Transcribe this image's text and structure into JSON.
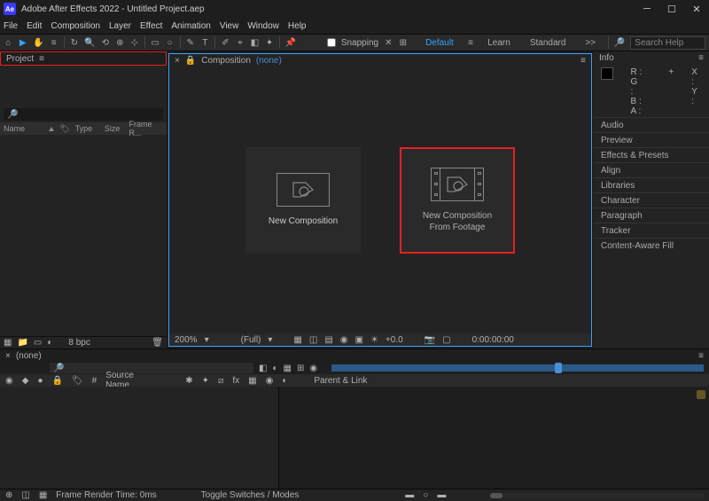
{
  "titlebar": {
    "logo": "Ae",
    "title": "Adobe After Effects 2022 - Untitled Project.aep"
  },
  "menu": [
    "File",
    "Edit",
    "Composition",
    "Layer",
    "Effect",
    "Animation",
    "View",
    "Window",
    "Help"
  ],
  "toolbar": {
    "snapping": "Snapping",
    "workspaces": [
      "Default",
      "Learn",
      "Standard"
    ],
    "chevrons": ">>",
    "search_placeholder": "Search Help"
  },
  "project": {
    "tab": "Project",
    "columns": {
      "name": "Name",
      "type": "Type",
      "size": "Size",
      "framerate": "Frame R..."
    },
    "footer_bpc": "8 bpc"
  },
  "composition": {
    "tab": "Composition",
    "none": "(none)",
    "card1": "New Composition",
    "card2_line1": "New Composition",
    "card2_line2": "From Footage",
    "footer": {
      "zoom": "200%",
      "time": "0:00:00:00",
      "exposure": "+0.0"
    }
  },
  "info": {
    "title": "Info",
    "rgba": [
      "R :",
      "G :",
      "B :",
      "A :"
    ],
    "xy": [
      "X :",
      "Y :"
    ]
  },
  "panels": [
    "Audio",
    "Preview",
    "Effects & Presets",
    "Align",
    "Libraries",
    "Character",
    "Paragraph",
    "Tracker",
    "Content-Aware Fill"
  ],
  "timeline": {
    "tab": "(none)",
    "source": "Source Name",
    "parent": "Parent & Link",
    "footer_left": "Frame Render Time: 0ms",
    "footer_toggle": "Toggle Switches / Modes"
  }
}
